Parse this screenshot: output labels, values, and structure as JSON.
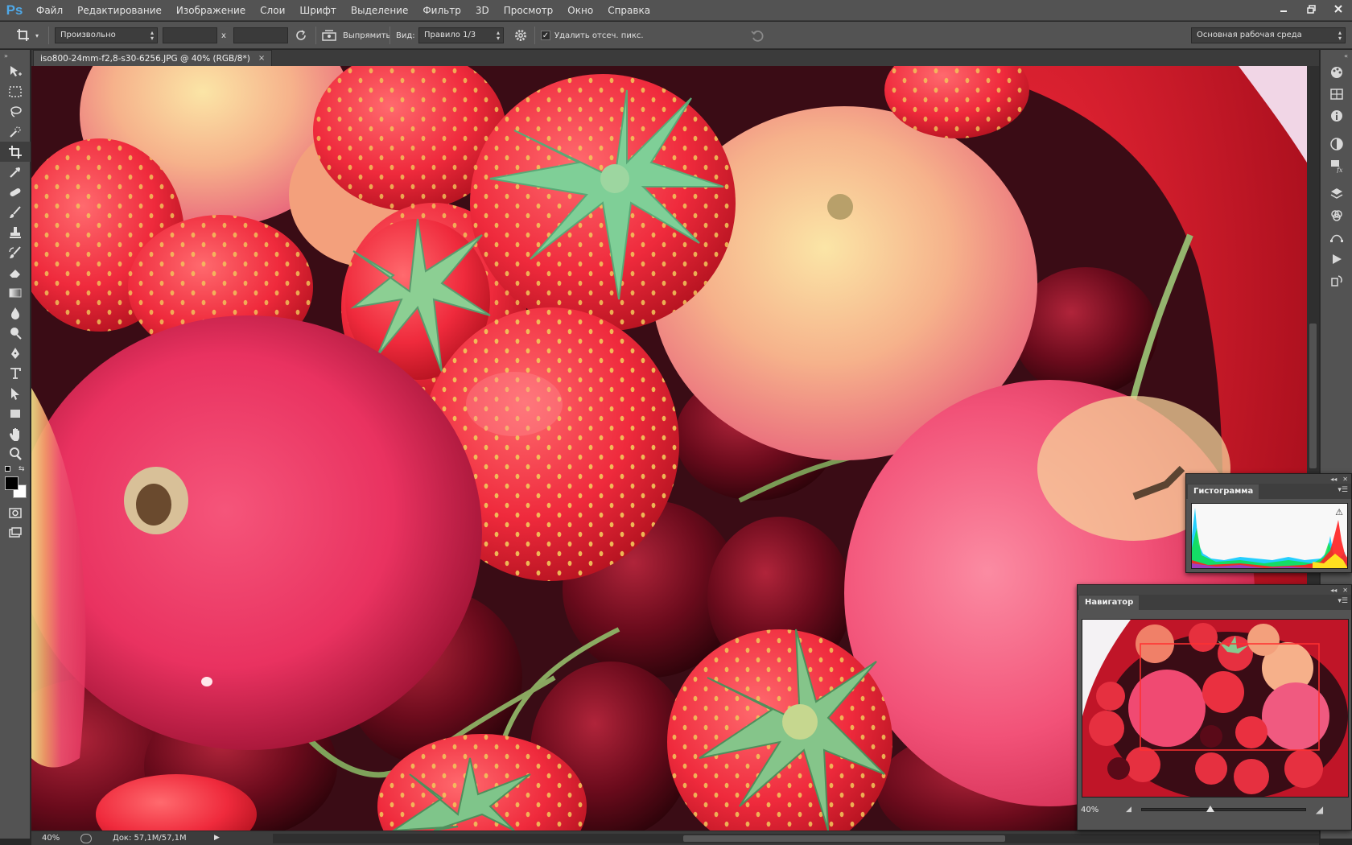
{
  "app": {
    "logo": "Ps",
    "menu": [
      "Файл",
      "Редактирование",
      "Изображение",
      "Слои",
      "Шрифт",
      "Выделение",
      "Фильтр",
      "3D",
      "Просмотр",
      "Окно",
      "Справка"
    ],
    "window_controls": [
      "minimize-icon",
      "restore-icon",
      "close-icon"
    ]
  },
  "options": {
    "ratio_preset": "Произвольно",
    "width_value": "",
    "height_value": "",
    "x_separator": "x",
    "straighten_label": "Выпрямить",
    "view_label": "Вид:",
    "view_overlay": "Правило 1/3",
    "delete_cropped_label": "Удалить отсеч. пикс.",
    "delete_cropped_checked": true,
    "workspace": "Основная рабочая среда"
  },
  "document": {
    "tab_title": "iso800-24mm-f2,8-s30-6256.JPG @ 40% (RGB/8*)",
    "close_glyph": "×"
  },
  "status": {
    "zoom": "40%",
    "doc_info": "Док: 57,1M/57,1M"
  },
  "histogram": {
    "tab": "Гистограмма",
    "warning_icon": "warning-icon"
  },
  "navigator": {
    "tab": "Навигатор",
    "zoom": "40%",
    "slider_fraction": 0.42
  },
  "tools": [
    "move-tool-icon",
    "marquee-tool-icon",
    "lasso-tool-icon",
    "quick-select-tool-icon",
    "crop-tool-icon",
    "eyedropper-tool-icon",
    "healing-tool-icon",
    "brush-tool-icon",
    "stamp-tool-icon",
    "history-brush-tool-icon",
    "eraser-tool-icon",
    "gradient-tool-icon",
    "blur-tool-icon",
    "dodge-tool-icon",
    "pen-tool-icon",
    "type-tool-icon",
    "path-select-tool-icon",
    "shape-tool-icon",
    "hand-tool-icon",
    "zoom-tool-icon"
  ],
  "colors": {
    "ui_dark": "#535353",
    "foreground": "#000000",
    "background": "#ffffff",
    "nav_box": "#ff3030"
  }
}
